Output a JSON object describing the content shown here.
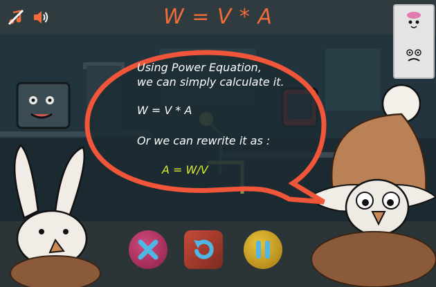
{
  "header": {
    "title": "W = V * A",
    "music_icon": "music-muted-icon",
    "sound_icon": "speaker-icon"
  },
  "bubble": {
    "line1": "Using Power Equation,",
    "line2": "we can simply calculate it.",
    "line3": "W = V * A",
    "line4": "Or we can rewrite it as :",
    "line5": "A = W/V"
  },
  "controls": {
    "close_icon": "close-icon",
    "restart_icon": "restart-icon",
    "pause_icon": "pause-icon"
  },
  "colors": {
    "title": "#f26b3a",
    "bubble_border": "#f2563a",
    "highlight": "#d9ea33",
    "header_bg": "#2f3b3f"
  }
}
